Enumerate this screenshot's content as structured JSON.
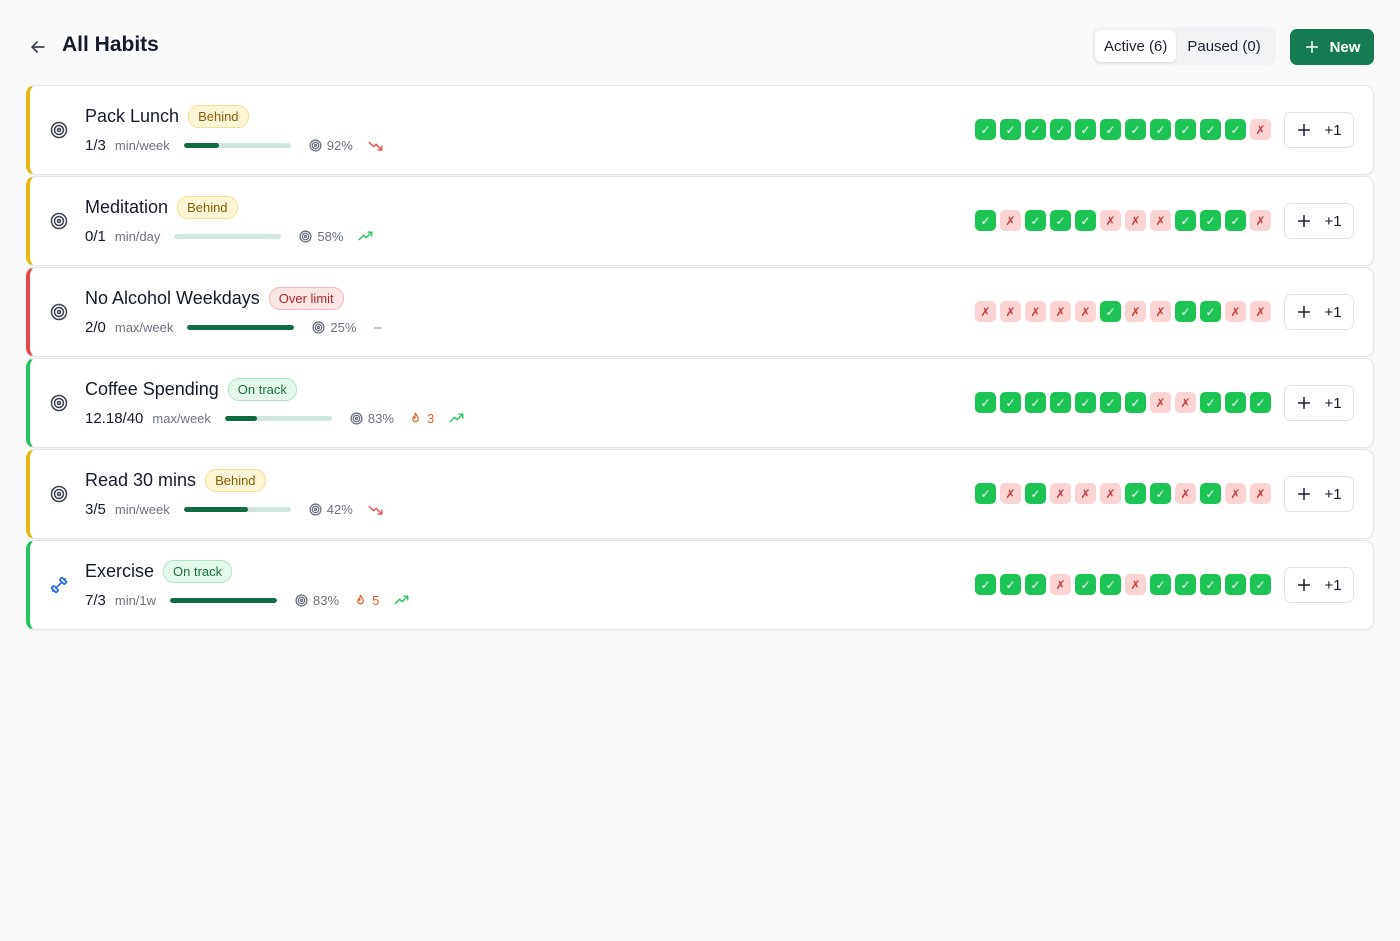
{
  "header": {
    "title": "All Habits",
    "filters": [
      {
        "label": "Active (6)",
        "active": true
      },
      {
        "label": "Paused (0)",
        "active": false
      }
    ],
    "new_label": "New"
  },
  "colors": {
    "accent_green": "#157b52",
    "status_behind": "#e8b511",
    "status_over": "#e5484d",
    "status_ok": "#22c55e",
    "done": "#1ec453",
    "missed": "#fbd3d3"
  },
  "add_label": "+1",
  "habits": [
    {
      "name": "Pack Lunch",
      "status": "Behind",
      "status_type": "behind",
      "icon": "target-icon",
      "progress": "1/3",
      "unit": "min/week",
      "progress_fraction": 0.33,
      "rate": "92%",
      "streak": "",
      "trend": "down",
      "history": [
        1,
        1,
        1,
        1,
        1,
        1,
        1,
        1,
        1,
        1,
        1,
        0
      ]
    },
    {
      "name": "Meditation",
      "status": "Behind",
      "status_type": "behind",
      "icon": "target-icon",
      "progress": "0/1",
      "unit": "min/day",
      "progress_fraction": 0,
      "rate": "58%",
      "streak": "",
      "trend": "up",
      "history": [
        1,
        0,
        1,
        1,
        1,
        0,
        0,
        0,
        1,
        1,
        1,
        0
      ]
    },
    {
      "name": "No Alcohol Weekdays",
      "status": "Over limit",
      "status_type": "over",
      "icon": "target-icon",
      "progress": "2/0",
      "unit": "max/week",
      "progress_fraction": 1,
      "rate": "25%",
      "streak": "",
      "trend": "flat",
      "history": [
        0,
        0,
        0,
        0,
        0,
        1,
        0,
        0,
        1,
        1,
        0,
        0
      ]
    },
    {
      "name": "Coffee Spending",
      "status": "On track",
      "status_type": "ok",
      "icon": "target-icon",
      "progress": "12.18/40",
      "unit": "max/week",
      "progress_fraction": 0.3,
      "rate": "83%",
      "streak": "3",
      "trend": "up",
      "history": [
        1,
        1,
        1,
        1,
        1,
        1,
        1,
        0,
        0,
        1,
        1,
        1
      ]
    },
    {
      "name": "Read 30 mins",
      "status": "Behind",
      "status_type": "behind",
      "icon": "target-icon",
      "progress": "3/5",
      "unit": "min/week",
      "progress_fraction": 0.6,
      "rate": "42%",
      "streak": "",
      "trend": "down",
      "history": [
        1,
        0,
        1,
        0,
        0,
        0,
        1,
        1,
        0,
        1,
        0,
        0
      ]
    },
    {
      "name": "Exercise",
      "status": "On track",
      "status_type": "ok",
      "icon": "dumbbell-icon",
      "progress": "7/3",
      "unit": "min/1w",
      "progress_fraction": 1,
      "rate": "83%",
      "streak": "5",
      "trend": "up",
      "history": [
        1,
        1,
        1,
        0,
        1,
        1,
        0,
        1,
        1,
        1,
        1,
        1
      ]
    }
  ]
}
